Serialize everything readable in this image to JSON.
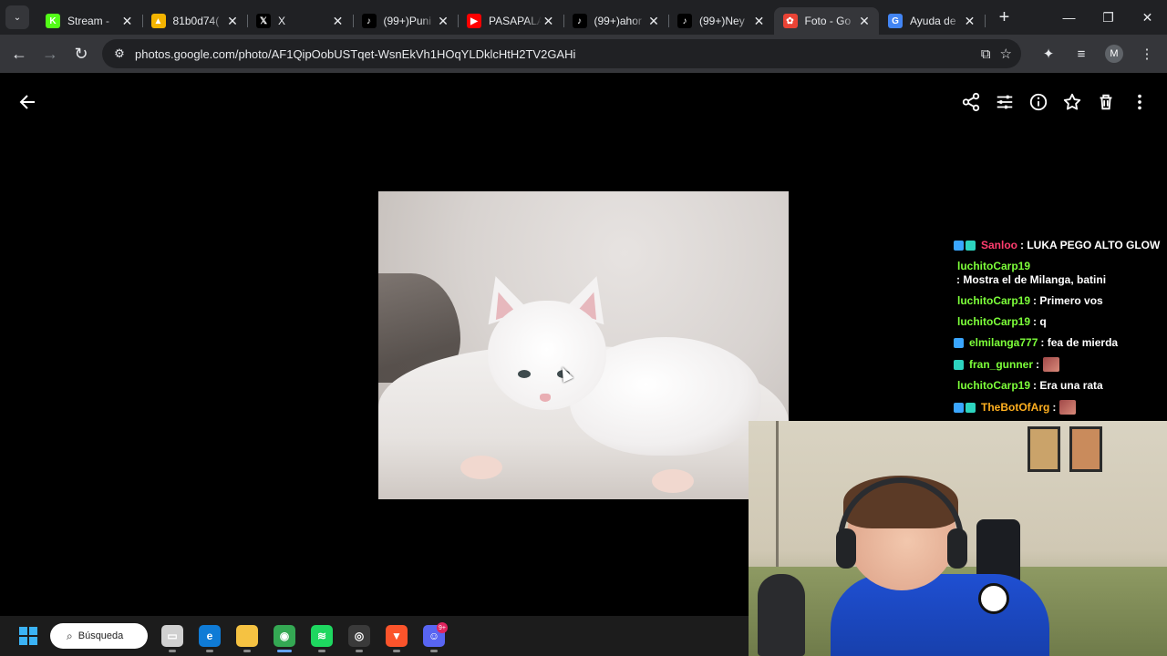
{
  "browser": {
    "tabs": [
      {
        "title": "Stream - ",
        "favicon": "kick-icon",
        "color": "#53fc18",
        "glyph": "K",
        "active": false
      },
      {
        "title": "81b0d74(",
        "favicon": "drive-icon",
        "color": "#f4b400",
        "glyph": "▲",
        "active": false
      },
      {
        "title": "X",
        "favicon": "x-icon",
        "color": "#000000",
        "glyph": "𝕏",
        "active": false
      },
      {
        "title": "(99+)Puni",
        "favicon": "tiktok-icon",
        "color": "#000000",
        "glyph": "♪",
        "active": false
      },
      {
        "title": "PASAPALA",
        "favicon": "youtube-icon",
        "color": "#ff0000",
        "glyph": "▶",
        "active": false
      },
      {
        "title": "(99+)ahor",
        "favicon": "tiktok-icon",
        "color": "#000000",
        "glyph": "♪",
        "active": false
      },
      {
        "title": "(99+)Ney",
        "favicon": "tiktok-icon",
        "color": "#000000",
        "glyph": "♪",
        "active": false
      },
      {
        "title": "Foto - Go",
        "favicon": "google-photos-icon",
        "color": "#ea4335",
        "glyph": "✿",
        "active": true
      },
      {
        "title": "Ayuda de",
        "favicon": "google-icon",
        "color": "#4285f4",
        "glyph": "G",
        "active": false
      }
    ],
    "close_glyph": "✕",
    "new_tab_glyph": "+",
    "window_controls": {
      "minimize": "—",
      "maximize": "❐",
      "close": "✕"
    },
    "url": "photos.google.com/photo/AF1QipOobUSTqet-WsnEkVh1HOqYLDklcHtH2TV2GAHi",
    "profile_initial": "M"
  },
  "viewer": {
    "actions": [
      "share-icon",
      "edit-icon",
      "info-icon",
      "favorite-icon",
      "delete-icon",
      "more-icon"
    ]
  },
  "chat": [
    {
      "user": "Sanloo",
      "user_color": "#ff3d6e",
      "text": ": LUKA PEGO ALTO GLOW",
      "badges": [
        "b-blue",
        "b-cyan"
      ],
      "emote": false
    },
    {
      "user": "luchitoCarp19",
      "user_color": "#7dff3a",
      "text": ": Mostra el de Milanga, batini",
      "badges": [],
      "emote": false
    },
    {
      "user": "luchitoCarp19",
      "user_color": "#7dff3a",
      "text": ": Primero vos",
      "badges": [],
      "emote": false
    },
    {
      "user": "luchitoCarp19",
      "user_color": "#7dff3a",
      "text": ": q",
      "badges": [],
      "emote": false
    },
    {
      "user": "elmilanga777",
      "user_color": "#7dff3a",
      "text": ": fea de mierda",
      "badges": [
        "b-blue"
      ],
      "emote": false
    },
    {
      "user": "fran_gunner",
      "user_color": "#7dff3a",
      "text": ":",
      "badges": [
        "b-cyan"
      ],
      "emote": true
    },
    {
      "user": "luchitoCarp19",
      "user_color": "#7dff3a",
      "text": ": Era una rata",
      "badges": [],
      "emote": false
    },
    {
      "user": "TheBotOfArg",
      "user_color": "#ffb020",
      "text": ":",
      "badges": [
        "b-blue",
        "b-cyan"
      ],
      "emote": true
    }
  ],
  "taskbar": {
    "search_label": "Búsqueda",
    "apps": [
      {
        "name": "task-view-icon",
        "color": "#d0d0d0",
        "glyph": "▭",
        "active": false,
        "badge": ""
      },
      {
        "name": "edge-icon",
        "color": "#0f7bd6",
        "glyph": "e",
        "active": false,
        "badge": ""
      },
      {
        "name": "file-explorer-icon",
        "color": "#f5c242",
        "glyph": "",
        "active": false,
        "badge": ""
      },
      {
        "name": "chrome-icon",
        "color": "#34a853",
        "glyph": "◉",
        "active": true,
        "badge": ""
      },
      {
        "name": "spotify-icon",
        "color": "#1ed760",
        "glyph": "≋",
        "active": false,
        "badge": ""
      },
      {
        "name": "obs-icon",
        "color": "#3a3a3a",
        "glyph": "◎",
        "active": false,
        "badge": ""
      },
      {
        "name": "brave-icon",
        "color": "#fb542b",
        "glyph": "▼",
        "active": false,
        "badge": ""
      },
      {
        "name": "discord-icon",
        "color": "#5865f2",
        "glyph": "☺",
        "active": false,
        "badge": "9+"
      }
    ]
  }
}
